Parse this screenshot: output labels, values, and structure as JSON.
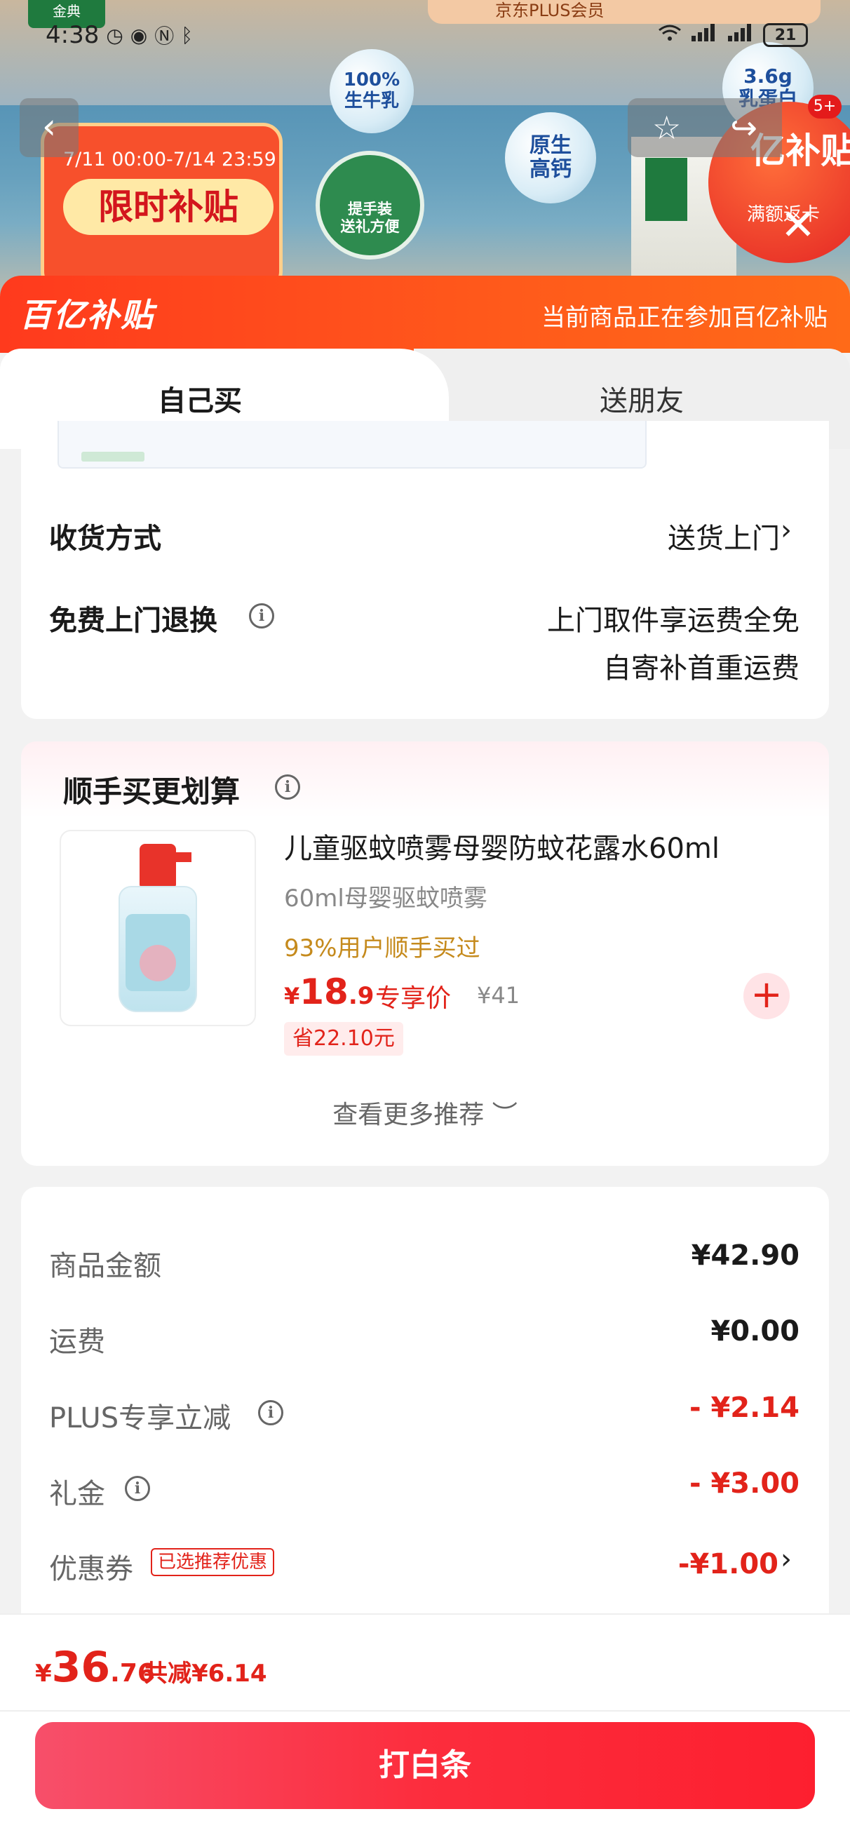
{
  "status_bar": {
    "time": "4:38",
    "battery": "21",
    "network": "4G"
  },
  "banner": {
    "brand": "金典",
    "plus_text": "京东PLUS会员",
    "badge_milk": "100%\n生牛乳",
    "badge_calcium": "原生\n高钙",
    "badge_protein": "3.6g\n乳蛋白",
    "promo_date": "7/11 00:00-7/14 23:59",
    "promo_title": "限时补贴",
    "green_disc": "提手装\n送礼方便",
    "roundel_title": "亿补贴",
    "roundel_sub": "满额返卡",
    "notification_count": "5+"
  },
  "sheet": {
    "logo": "百亿补贴",
    "note": "当前商品正在参加百亿补贴"
  },
  "tabs": [
    {
      "label": "自己买",
      "active": true
    },
    {
      "label": "送朋友",
      "active": false
    }
  ],
  "delivery": {
    "method_label": "收货方式",
    "method_value": "送货上门",
    "return_label": "免费上门退换",
    "return_line1": "上门取件享运费全免",
    "return_line2": "自寄补首重运费"
  },
  "upsell": {
    "title": "顺手买更划算",
    "product_title": "儿童驱蚊喷雾母婴防蚊花露水60ml",
    "product_sub": "60ml母婴驱蚊喷雾",
    "bought_rate": "93%用户顺手买过",
    "price_currency": "¥",
    "price_int": "18",
    "price_dec": ".9",
    "price_tag": "专享价",
    "orig_price": "¥41",
    "save": "省22.10元",
    "add_icon": "plus-icon",
    "more": "查看更多推荐 ︶"
  },
  "summary": {
    "rows": [
      {
        "label": "商品金额",
        "value": "¥42.90"
      },
      {
        "label": "运费",
        "value": "¥0.00"
      },
      {
        "label": "PLUS专享立减",
        "value": "- ¥2.14"
      },
      {
        "label": "礼金",
        "value": "- ¥3.00"
      },
      {
        "label": "优惠券",
        "value": "-¥1.00"
      }
    ],
    "coupon_chip": "已选推荐优惠"
  },
  "bottom": {
    "total_currency": "¥",
    "total_int": "36",
    "total_dec": ".76",
    "total_off": "共减¥6.14",
    "pay_label": "打白条"
  },
  "colors": {
    "accent_red": "#e2231a",
    "header_orange": "#ff4a1c",
    "bought_gold": "#c58a1c"
  }
}
